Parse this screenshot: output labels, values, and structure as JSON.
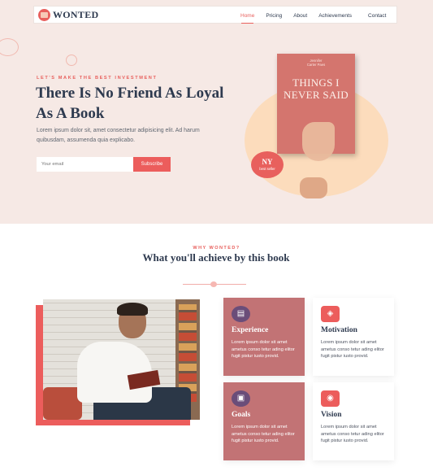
{
  "brand": {
    "name": "WONTED"
  },
  "nav": {
    "items": [
      "Home",
      "Pricing",
      "About",
      "Achievements",
      "Contact"
    ],
    "active": "Home"
  },
  "hero": {
    "kicker": "LET'S MAKE THE BEST INVESTMENT",
    "title": "There Is No Friend As Loyal As A Book",
    "description": "Lorem ipsum dolor sit, amet consectetur adipisicing elit. Ad harum quibusdam, assumenda quia explicabo.",
    "email_placeholder": "Your email",
    "subscribe_label": "Subscribe",
    "book_author": "Jennifer\nCarter Paes",
    "book_title": "THINGS I NEVER SAID",
    "badge_big": "NY",
    "badge_small": "best seller"
  },
  "why": {
    "kicker": "WHY WONTED?",
    "title": "What you'll achieve by this book"
  },
  "features": [
    {
      "title": "Experience",
      "text": "Lorem ipsum dolor sit amet ametus conso tetur ading elitor fugit pistur iusto provid.",
      "icon": "book-icon"
    },
    {
      "title": "Motivation",
      "text": "Lorem ipsum dolor sit amet ametus conso tetur ading elitor fugit pistur iusto provid.",
      "icon": "cube-icon"
    },
    {
      "title": "Goals",
      "text": "Lorem ipsum dolor sit amet ametus conso tetur ading elitor fugit pistur iusto provid.",
      "icon": "radio-icon"
    },
    {
      "title": "Vision",
      "text": "Lorem ipsum dolor sit amet ametus conso tetur ading elitor fugit pistur iusto provid.",
      "icon": "target-icon"
    }
  ],
  "colors": {
    "accent": "#e8605d",
    "navy": "#2e3a4f",
    "hero_bg": "#f6e9e5",
    "card_pink": "#c27375"
  }
}
